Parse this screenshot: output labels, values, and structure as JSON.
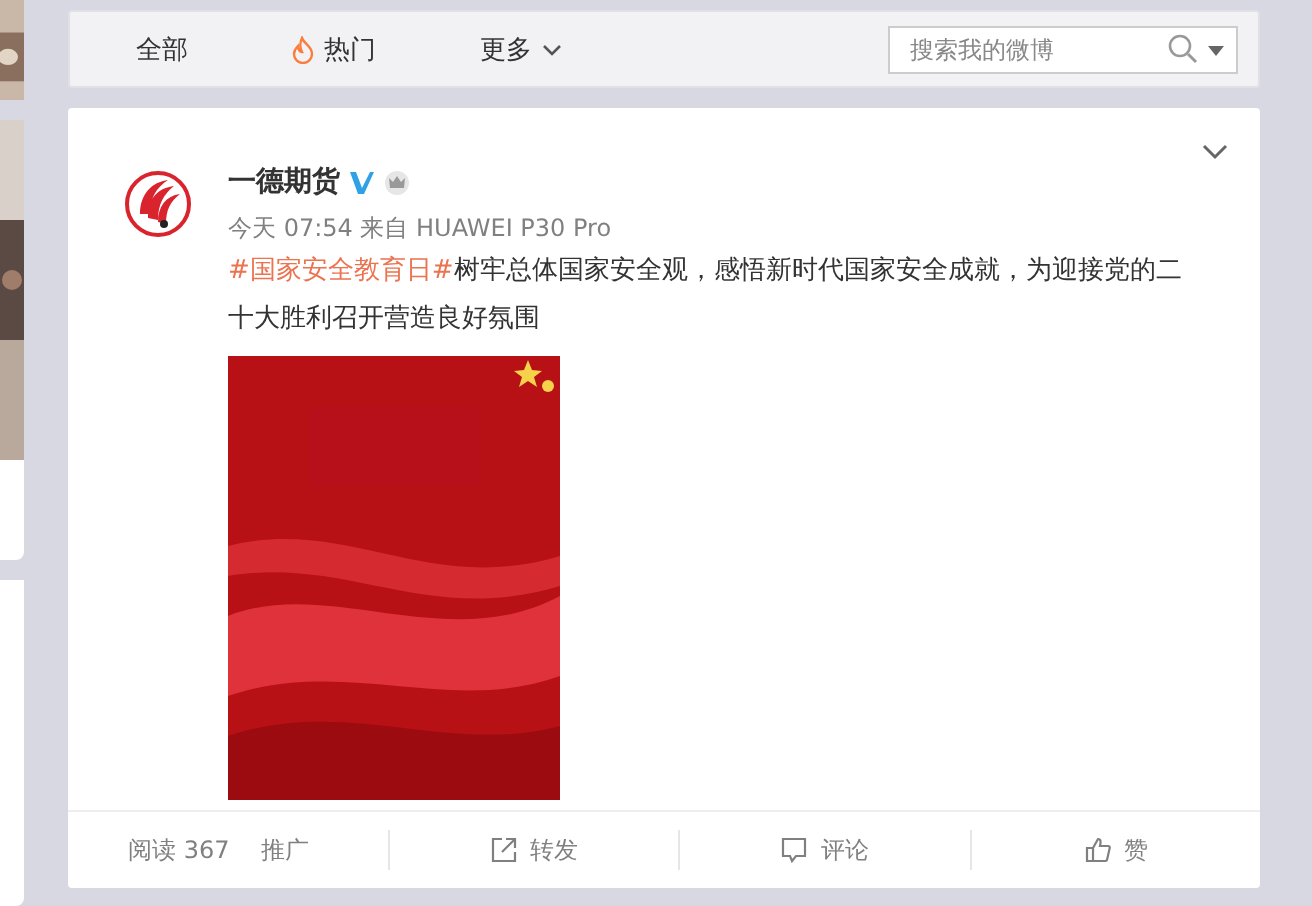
{
  "nav": {
    "tabs": [
      {
        "label": "全部",
        "selected": false,
        "kind": "plain"
      },
      {
        "label": "热门",
        "selected": false,
        "kind": "hot"
      },
      {
        "label": "更多",
        "selected": false,
        "kind": "menu"
      }
    ],
    "search": {
      "placeholder": "搜索我的微博"
    }
  },
  "post": {
    "author": "一德期货",
    "verified": true,
    "meta": "今天 07:54 来自 HUAWEI P30 Pro",
    "topic": "#国家安全教育日#",
    "text": "树牢总体国家安全观，感悟新时代国家安全成就，为迎接党的二十大胜利召开营造良好氛围"
  },
  "footer": {
    "reads": "阅读 367",
    "promote": "推广",
    "actions": [
      {
        "kind": "repost",
        "label": "转发"
      },
      {
        "kind": "comment",
        "label": "评论"
      },
      {
        "kind": "like",
        "label": "赞"
      }
    ]
  }
}
